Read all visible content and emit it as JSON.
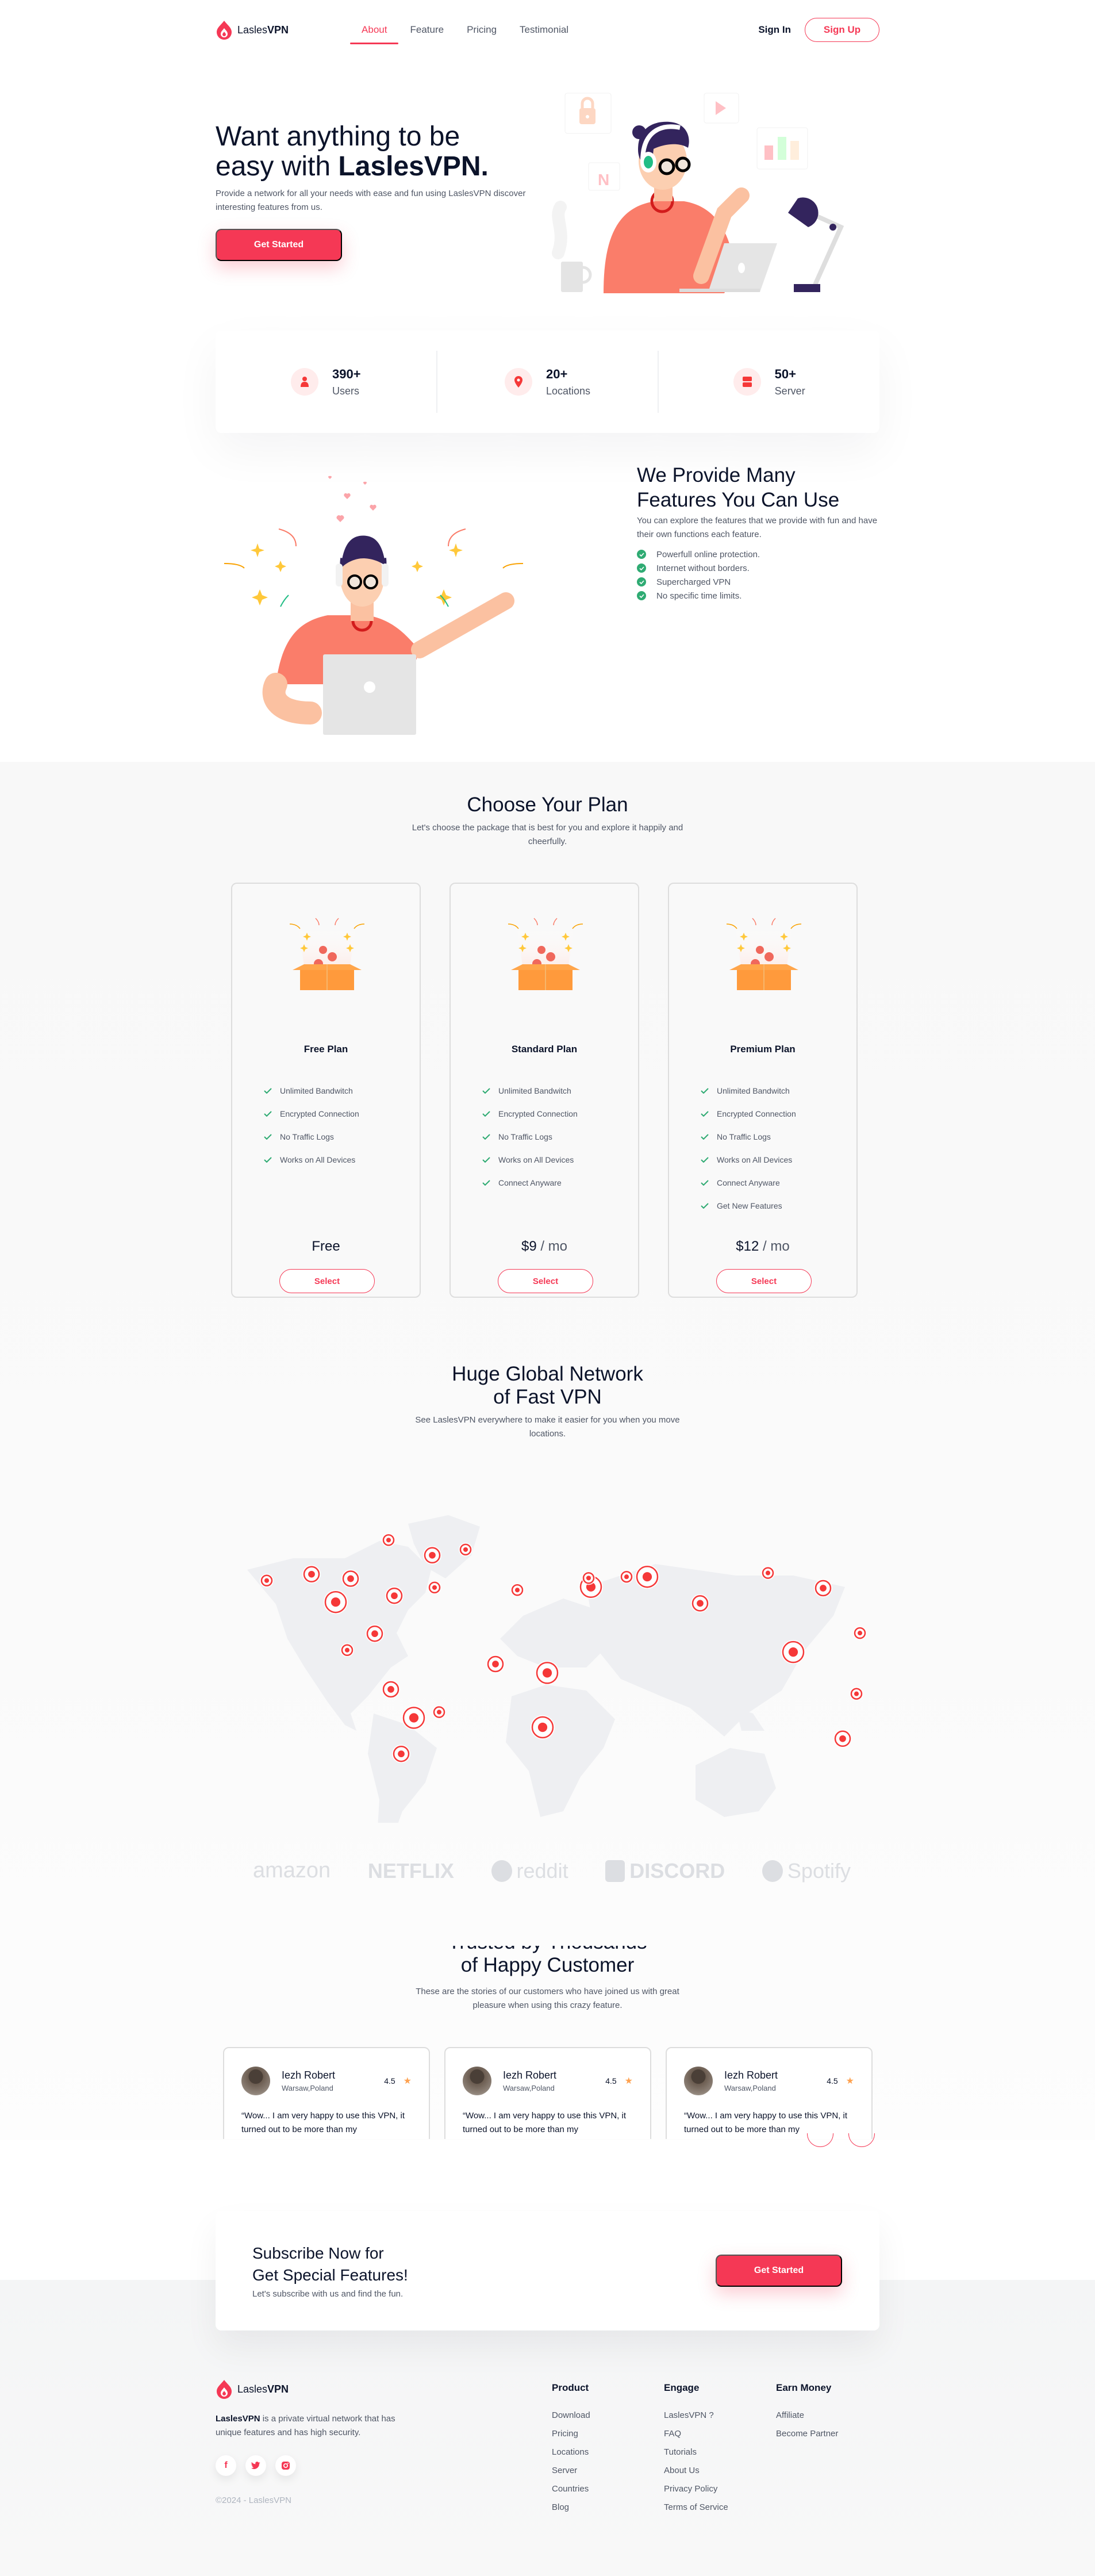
{
  "brand": {
    "name_light": "Lasles",
    "name_bold": "VPN",
    "accent": "#f53855",
    "dark": "#0b132a",
    "muted": "#4f5665",
    "success": "#2fab73"
  },
  "nav": {
    "links": [
      {
        "label": "About",
        "active": true
      },
      {
        "label": "Feature",
        "active": false
      },
      {
        "label": "Pricing",
        "active": false
      },
      {
        "label": "Testimonial",
        "active": false
      }
    ],
    "sign_in": "Sign In",
    "sign_up": "Sign Up"
  },
  "hero": {
    "title_line1": "Want anything to be",
    "title_line2_pre": "easy with ",
    "title_line2_bold": "LaslesVPN.",
    "subtitle": "Provide a network for all your needs with ease and fun using LaslesVPN discover interesting features from us.",
    "cta": "Get Started",
    "illustration_tiles": [
      "lock-icon",
      "play-icon",
      "netflix-n-icon",
      "bar-chart-icon"
    ]
  },
  "stats": [
    {
      "value": "390+",
      "label": "Users",
      "icon": "user-icon"
    },
    {
      "value": "20+",
      "label": "Locations",
      "icon": "location-pin-icon"
    },
    {
      "value": "50+",
      "label": "Server",
      "icon": "server-icon"
    }
  ],
  "features": {
    "title_line1": "We Provide Many",
    "title_line2": "Features You Can Use",
    "description": "You can explore the features that we provide with fun and have their own functions each feature.",
    "items": [
      "Powerfull online protection.",
      "Internet without borders.",
      "Supercharged VPN",
      "No specific time limits."
    ]
  },
  "pricing": {
    "title": "Choose Your Plan",
    "subtitle_line1": "Let's choose the package that is best for you and explore it happily and",
    "subtitle_line2": "cheerfully.",
    "plans": [
      {
        "name": "Free Plan",
        "features": [
          "Unlimited Bandwitch",
          "Encrypted Connection",
          "No Traffic Logs",
          "Works on All Devices"
        ],
        "price": "Free",
        "per": "",
        "button": "Select"
      },
      {
        "name": "Standard Plan",
        "features": [
          "Unlimited Bandwitch",
          "Encrypted Connection",
          "No Traffic Logs",
          "Works on All Devices",
          "Connect Anyware"
        ],
        "price": "$9",
        "per": " / mo",
        "button": "Select"
      },
      {
        "name": "Premium Plan",
        "features": [
          "Unlimited Bandwitch",
          "Encrypted Connection",
          "No Traffic Logs",
          "Works on All Devices",
          "Connect Anyware",
          "Get New Features"
        ],
        "price": "$12",
        "per": " / mo",
        "button": "Select"
      }
    ]
  },
  "network": {
    "title_line1": "Huge Global Network",
    "title_line2": "of Fast VPN",
    "subtitle_line1": "See LaslesVPN everywhere to make it easier for you when you move",
    "subtitle_line2": "locations.",
    "partners": [
      "amazon",
      "NETFLIX",
      "reddit",
      "DISCORD",
      "Spotify"
    ]
  },
  "testimonials": {
    "title_line1": "Trusted by Thousands",
    "title_line2": "of Happy Customer",
    "subtitle_line1": "These are the stories of our customers who have joined us with great",
    "subtitle_line2": "pleasure when using this crazy feature.",
    "items": [
      {
        "name": "Iezh Robert",
        "location": "Warsaw,Poland",
        "rating": "4.5",
        "text": "“Wow... I am very happy to use this VPN, it turned out to be more than my"
      },
      {
        "name": "Iezh Robert",
        "location": "Warsaw,Poland",
        "rating": "4.5",
        "text": "“Wow... I am very happy to use this VPN, it turned out to be more than my"
      },
      {
        "name": "Iezh Robert",
        "location": "Warsaw,Poland",
        "rating": "4.5",
        "text": "“Wow... I am very happy to use this VPN, it turned out to be more than my"
      }
    ]
  },
  "subscribe": {
    "title_line1": "Subscribe Now for",
    "title_line2": "Get Special Features!",
    "description": "Let's subscribe with us and find the fun.",
    "cta": "Get Started"
  },
  "footer": {
    "about_bold": "LaslesVPN",
    "about_rest": " is a private virtual network that has unique features and has high security.",
    "socials": [
      "facebook-icon",
      "twitter-icon",
      "instagram-icon"
    ],
    "copyright": "©2024 - LaslesVPN",
    "columns": [
      {
        "title": "Product",
        "links": [
          "Download",
          "Pricing",
          "Locations",
          "Server",
          "Countries",
          "Blog"
        ]
      },
      {
        "title": "Engage",
        "links": [
          "LaslesVPN ?",
          "FAQ",
          "Tutorials",
          "About Us",
          "Privacy Policy",
          "Terms of Service"
        ]
      },
      {
        "title": "Earn Money",
        "links": [
          "Affiliate",
          "Become Partner"
        ]
      }
    ]
  }
}
